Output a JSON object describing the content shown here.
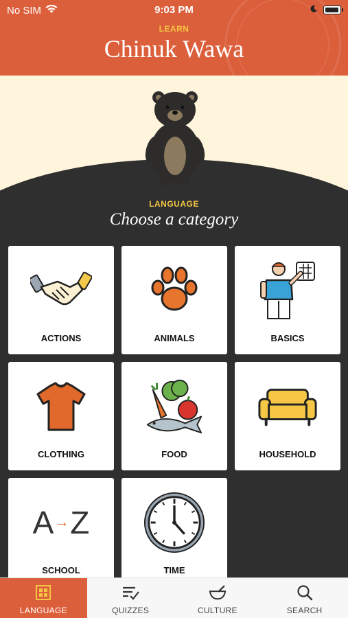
{
  "status_bar": {
    "carrier": "No SIM",
    "time": "9:03 PM"
  },
  "header": {
    "kicker": "LEARN",
    "title": "Chinuk Wawa"
  },
  "section": {
    "kicker": "LANGUAGE",
    "heading": "Choose a category"
  },
  "categories": [
    {
      "label": "ACTIONS",
      "icon": "handshake-icon"
    },
    {
      "label": "ANIMALS",
      "icon": "paw-icon"
    },
    {
      "label": "BASICS",
      "icon": "person-waving-icon"
    },
    {
      "label": "CLOTHING",
      "icon": "shirt-icon"
    },
    {
      "label": "FOOD",
      "icon": "food-icon"
    },
    {
      "label": "HOUSEHOLD",
      "icon": "sofa-icon"
    },
    {
      "label": "SCHOOL",
      "icon": "a-to-z-icon"
    },
    {
      "label": "TIME",
      "icon": "clock-icon"
    }
  ],
  "school_icon_text": {
    "from": "A",
    "to": "Z"
  },
  "tabs": [
    {
      "label": "LANGUAGE",
      "icon": "grid-icon",
      "active": true
    },
    {
      "label": "QUIZZES",
      "icon": "checklist-icon",
      "active": false
    },
    {
      "label": "CULTURE",
      "icon": "bowl-icon",
      "active": false
    },
    {
      "label": "SEARCH",
      "icon": "search-icon",
      "active": false
    }
  ],
  "colors": {
    "accent": "#dc5f3c",
    "gold": "#f6c744",
    "cream": "#fff5dc",
    "dark": "#2f2f2f"
  }
}
